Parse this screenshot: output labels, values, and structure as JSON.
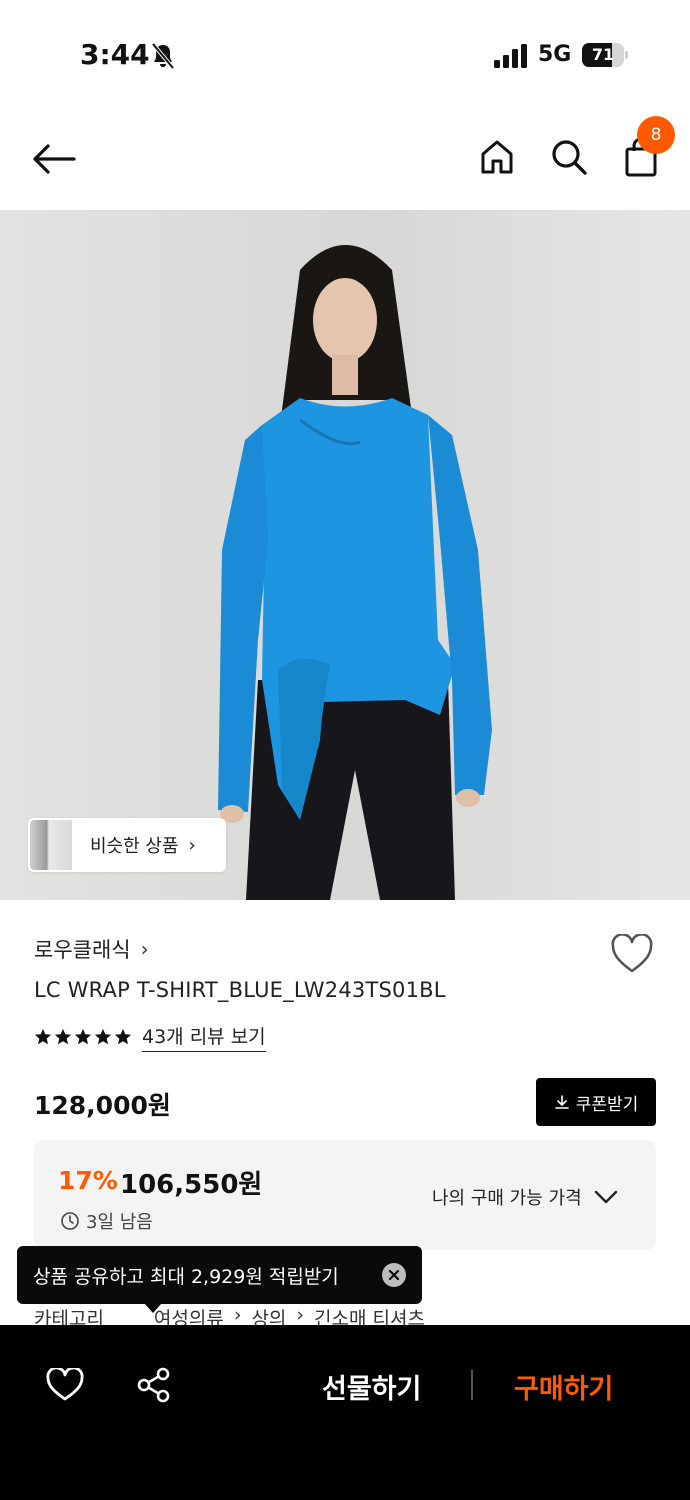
{
  "status_bar": {
    "time": "3:44",
    "network": "5G",
    "battery": "71",
    "battery_level": 0.71
  },
  "header": {
    "cart_count": "8"
  },
  "hero": {
    "similar_products_label": "비슷한 상품"
  },
  "product": {
    "brand": "로우클래식",
    "title": "LC WRAP T-SHIRT_BLUE_LW243TS01BL",
    "rating_stars": 5,
    "review_link": "43개 리뷰 보기",
    "list_price": "128,000원",
    "coupon_button": "쿠폰받기",
    "discount_rate": "17%",
    "sale_price": "106,550원",
    "time_left": "3일 남음",
    "my_price_label": "나의 구매 가능 가격"
  },
  "category": {
    "label": "카테고리",
    "path": [
      "여성의류",
      "상의",
      "긴소매 티셔츠"
    ]
  },
  "toast": {
    "message": "상품 공유하고 최대 2,929원 적립받기"
  },
  "bottom_bar": {
    "gift_label": "선물하기",
    "buy_label": "구매하기"
  },
  "colors": {
    "accent": "#ff5a00",
    "shirt_blue": "#1e95e0",
    "bottom_bar_bg": "#000000"
  }
}
